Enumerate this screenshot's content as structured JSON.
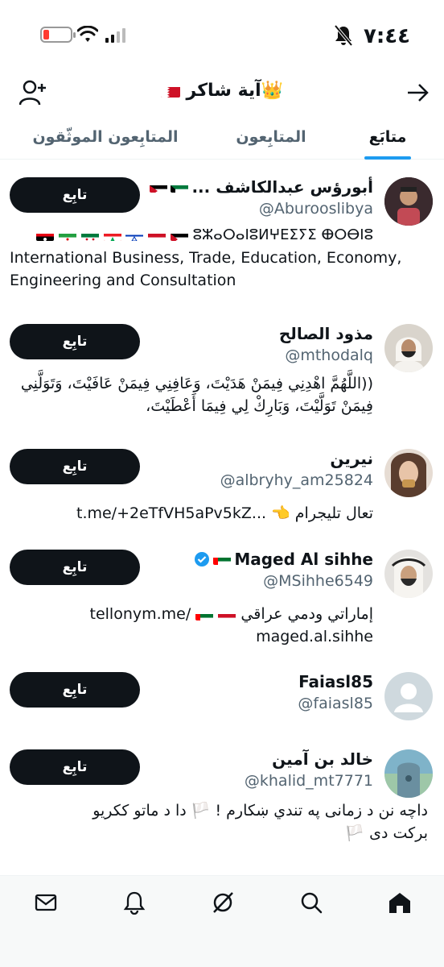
{
  "status_bar": {
    "time": "٧:٤٤",
    "battery_level": 0.1
  },
  "header": {
    "title": "آية شاكر"
  },
  "tabs": [
    {
      "label": "متابَع",
      "active": true
    },
    {
      "label": "المتابِعون",
      "active": false
    },
    {
      "label": "المتابِعون الموثّقون",
      "active": false
    }
  ],
  "users": [
    {
      "name": "أبورؤس عبدالكاشف ...",
      "handle": "@Aburooslibya",
      "follow_label": "تابِع",
      "bio_line1": "ⵓⵣⴰⵔⴰⵏⵓⵍⵖⴹⵉⵢⵉ ⴲⵔⴱⵏⵓ",
      "bio_en": "International Business, Trade, Education, Economy, Engineering and Consultation"
    },
    {
      "name": "مذود الصالح",
      "handle": "@mthodalq",
      "follow_label": "تابِع",
      "bio": "((اللَّهُمَّ اهْدِنِي فِيمَنْ هَدَيْتَ، وَعَافِنِي فِيمَنْ عَافَيْتَ، وَتَوَلَّنِي فِيمَنْ تَوَلَّيْتَ، وَبَارِكْ لِي فِيمَا أَعْطَيْتَ،"
    },
    {
      "name": "نيرين",
      "handle": "@albryhy_am25824",
      "follow_label": "تابِع",
      "bio_text": "تعال تليجرام",
      "bio_link": "t.me/+2eTfVH5aPv5kZ..."
    },
    {
      "name": "Maged Al sihhe",
      "handle": "@MSihhe6549",
      "follow_label": "تابِع",
      "bio_text": "إماراتي ودمي عراقي",
      "bio_link": "tellonym.me/",
      "bio_link2": "maged.al.sihhe"
    },
    {
      "name": "Faiasl85",
      "handle": "@faiasl85",
      "follow_label": "تابِع"
    },
    {
      "name": "خالد بن آمين",
      "handle": "@khalid_mt7771",
      "follow_label": "تابِع",
      "bio_a": "داچه نن د زمانی په تندي ښکارم !",
      "bio_b": "دا د ماتو ککریو",
      "bio_c": "برکت دی"
    }
  ],
  "nav": [
    "home-icon",
    "search-icon",
    "grok-icon",
    "notifications-icon",
    "messages-icon"
  ],
  "colors": {
    "accent": "#1d9bf0",
    "button": "#0f1419",
    "muted": "#536471"
  }
}
